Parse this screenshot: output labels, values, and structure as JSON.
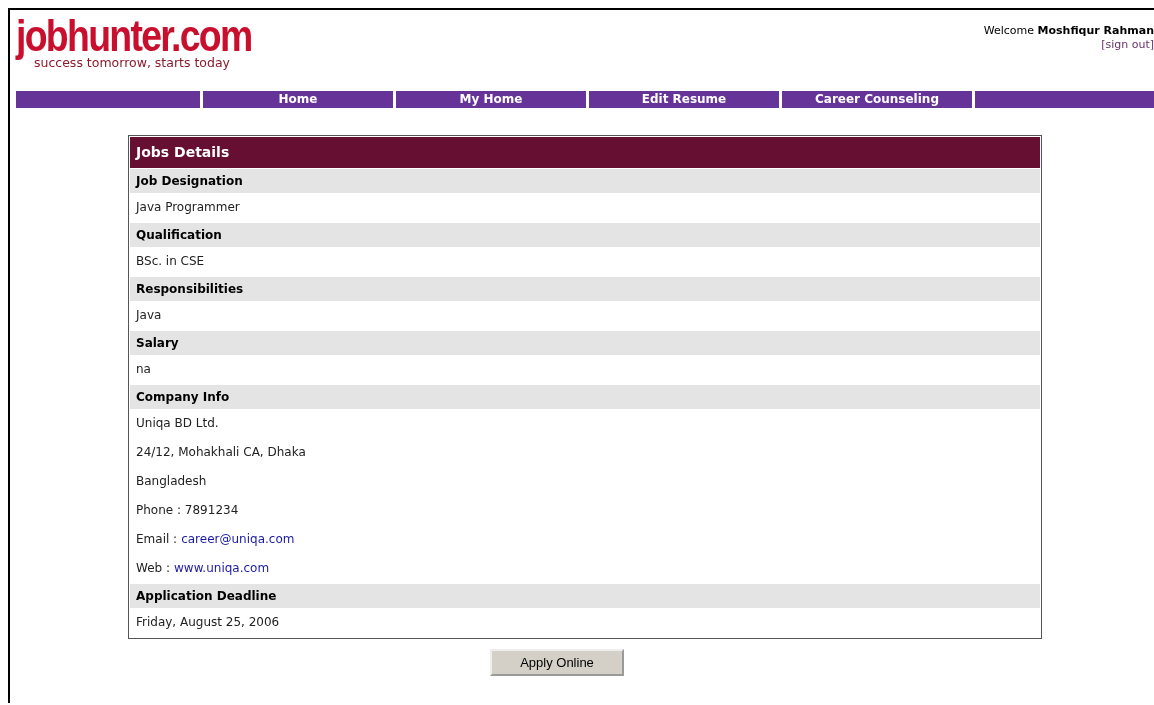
{
  "logo": {
    "name": "jobhunter.com",
    "tagline": "success tomorrow, starts today"
  },
  "user": {
    "greeting": "Welcome",
    "name": "Moshfiqur Rahman",
    "sign_out": "[sign out]"
  },
  "nav": [
    {
      "label": "Home"
    },
    {
      "label": "My Home"
    },
    {
      "label": "Edit Resume"
    },
    {
      "label": "Career Counseling"
    }
  ],
  "details": {
    "title": "Jobs Details",
    "sections": [
      {
        "heading": "Job Designation",
        "lines": [
          {
            "kind": "text",
            "text": "Java Programmer"
          }
        ]
      },
      {
        "heading": "Qualification",
        "lines": [
          {
            "kind": "text",
            "text": "BSc. in CSE"
          }
        ]
      },
      {
        "heading": "Responsibilities",
        "lines": [
          {
            "kind": "text",
            "text": "Java"
          }
        ]
      },
      {
        "heading": "Salary",
        "lines": [
          {
            "kind": "text",
            "text": "na"
          }
        ]
      },
      {
        "heading": "Company Info",
        "lines": [
          {
            "kind": "text",
            "text": "Uniqa BD Ltd."
          },
          {
            "kind": "text",
            "text": "24/12, Mohakhali CA, Dhaka"
          },
          {
            "kind": "text",
            "text": "Bangladesh"
          },
          {
            "kind": "text",
            "text": "Phone : 7891234"
          },
          {
            "kind": "link",
            "label": "Email :",
            "link": "career@uniqa.com"
          },
          {
            "kind": "link",
            "label": "Web :",
            "link": "www.uniqa.com"
          }
        ]
      },
      {
        "heading": "Application Deadline",
        "lines": [
          {
            "kind": "text",
            "text": "Friday, August 25, 2006"
          }
        ]
      }
    ]
  },
  "apply_button": "Apply Online"
}
